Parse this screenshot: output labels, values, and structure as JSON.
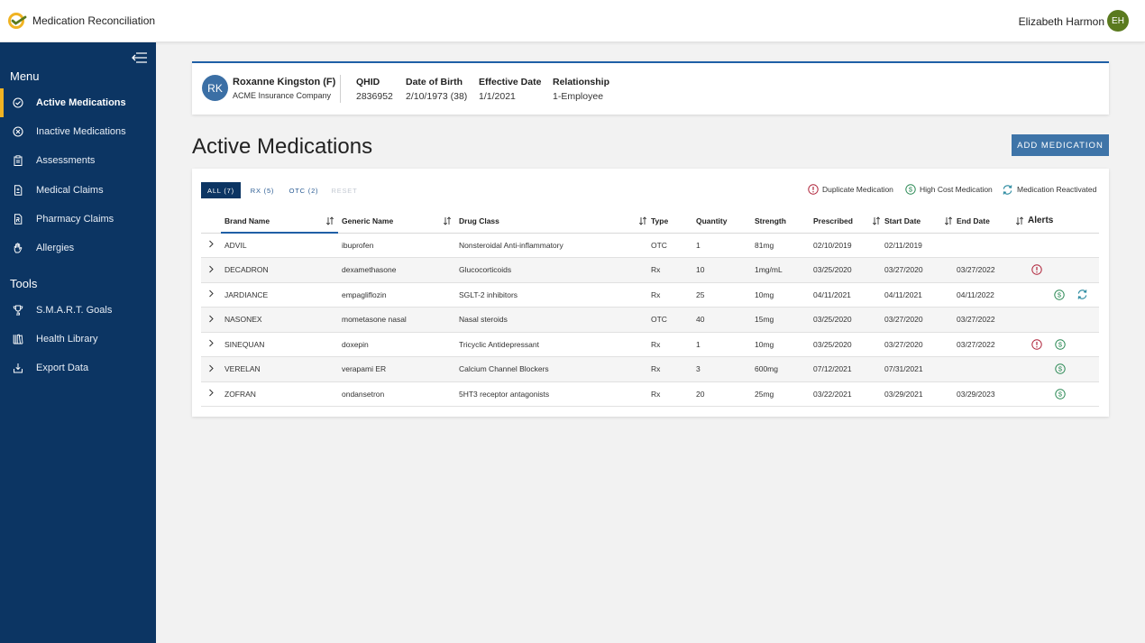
{
  "app": {
    "title": "Medication Reconciliation",
    "user_name": "Elizabeth Harmon",
    "user_initials": "EH"
  },
  "sidebar": {
    "menu_label": "Menu",
    "tools_label": "Tools",
    "menu_items": [
      {
        "label": "Active Medications",
        "icon": "check-circle-icon",
        "active": true
      },
      {
        "label": "Inactive Medications",
        "icon": "x-circle-icon",
        "active": false
      },
      {
        "label": "Assessments",
        "icon": "clipboard-icon",
        "active": false
      },
      {
        "label": "Medical Claims",
        "icon": "claim-document-icon",
        "active": false
      },
      {
        "label": "Pharmacy Claims",
        "icon": "pharmacy-document-icon",
        "active": false
      },
      {
        "label": "Allergies",
        "icon": "hand-icon",
        "active": false
      }
    ],
    "tool_items": [
      {
        "label": "S.M.A.R.T. Goals",
        "icon": "trophy-icon"
      },
      {
        "label": "Health Library",
        "icon": "library-icon"
      },
      {
        "label": "Export Data",
        "icon": "export-icon"
      }
    ]
  },
  "patient": {
    "initials": "RK",
    "name": "Roxanne Kingston (F)",
    "company": "ACME Insurance Company",
    "fields": [
      {
        "label": "QHID",
        "value": "2836952"
      },
      {
        "label": "Date of Birth",
        "value": "2/10/1973 (38)"
      },
      {
        "label": "Effective Date",
        "value": "1/1/2021"
      },
      {
        "label": "Relationship",
        "value": "1-Employee"
      }
    ]
  },
  "page": {
    "title": "Active Medications",
    "add_button": "ADD MEDICATION"
  },
  "filters": {
    "all": "ALL (7)",
    "rx": "RX (5)",
    "otc": "OTC (2)",
    "reset": "RESET"
  },
  "legend": {
    "duplicate": "Duplicate Medication",
    "high_cost": "High Cost Medication",
    "reactivated": "Medication Reactivated"
  },
  "colors": {
    "sidebar": "#0c3563",
    "accent": "#f0b323",
    "duplicate": "#b0263c",
    "high_cost": "#2e8b57",
    "reactivated": "#2a8aa0",
    "button": "#3e74a8"
  },
  "table": {
    "headers": {
      "brand": "Brand Name",
      "generic": "Generic Name",
      "drug_class": "Drug Class",
      "type": "Type",
      "quantity": "Quantity",
      "strength": "Strength",
      "prescribed": "Prescribed",
      "start": "Start Date",
      "end": "End Date",
      "alerts": "Alerts"
    },
    "rows": [
      {
        "brand": "ADVIL",
        "generic": "ibuprofen",
        "drug_class": "Nonsteroidal Anti-inflammatory",
        "type": "OTC",
        "quantity": "1",
        "strength": "81mg",
        "prescribed": "02/10/2019",
        "start": "02/11/2019",
        "end": "",
        "alerts": []
      },
      {
        "brand": "DECADRON",
        "generic": "dexamethasone",
        "drug_class": "Glucocorticoids",
        "type": "Rx",
        "quantity": "10",
        "strength": "1mg/mL",
        "prescribed": "03/25/2020",
        "start": "03/27/2020",
        "end": "03/27/2022",
        "alerts": [
          "duplicate"
        ]
      },
      {
        "brand": "JARDIANCE",
        "generic": "empagliflozin",
        "drug_class": "SGLT-2 inhibitors",
        "type": "Rx",
        "quantity": "25",
        "strength": "10mg",
        "prescribed": "04/11/2021",
        "start": "04/11/2021",
        "end": "04/11/2022",
        "alerts": [
          "",
          "high_cost",
          "reactivated"
        ]
      },
      {
        "brand": "NASONEX",
        "generic": "mometasone nasal",
        "drug_class": "Nasal steroids",
        "type": "OTC",
        "quantity": "40",
        "strength": "15mg",
        "prescribed": "03/25/2020",
        "start": "03/27/2020",
        "end": "03/27/2022",
        "alerts": []
      },
      {
        "brand": "SINEQUAN",
        "generic": "doxepin",
        "drug_class": "Tricyclic Antidepressant",
        "type": "Rx",
        "quantity": "1",
        "strength": "10mg",
        "prescribed": "03/25/2020",
        "start": "03/27/2020",
        "end": "03/27/2022",
        "alerts": [
          "duplicate",
          "high_cost"
        ]
      },
      {
        "brand": "VERELAN",
        "generic": "verapami ER",
        "drug_class": "Calcium Channel Blockers",
        "type": "Rx",
        "quantity": "3",
        "strength": "600mg",
        "prescribed": "07/12/2021",
        "start": "07/31/2021",
        "end": "",
        "alerts": [
          "",
          "high_cost"
        ]
      },
      {
        "brand": "ZOFRAN",
        "generic": "ondansetron",
        "drug_class": "5HT3 receptor antagonists",
        "type": "Rx",
        "quantity": "20",
        "strength": "25mg",
        "prescribed": "03/22/2021",
        "start": "03/29/2021",
        "end": "03/29/2023",
        "alerts": [
          "",
          "high_cost"
        ]
      }
    ]
  }
}
